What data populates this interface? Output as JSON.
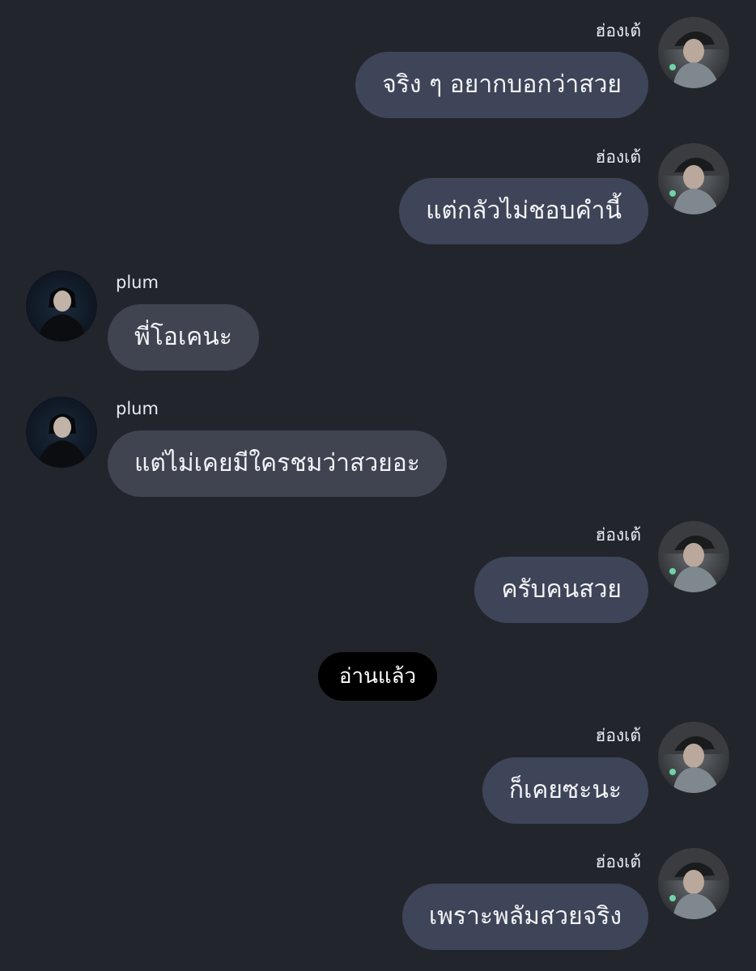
{
  "colors": {
    "background": "#23252d",
    "outgoing_bubble": "#3e4558",
    "incoming_bubble": "#404450",
    "read_pill": "#000000",
    "text": "#f3f4f7"
  },
  "messages": [
    {
      "sender": "ฮ่องเต้",
      "side": "right",
      "text": "จริง ๆ อยากบอกว่าสวย"
    },
    {
      "sender": "ฮ่องเต้",
      "side": "right",
      "text": "แต่กลัวไม่ชอบคำนี้"
    },
    {
      "sender": "plum",
      "side": "left",
      "text": "พี่โอเคนะ"
    },
    {
      "sender": "plum",
      "side": "left",
      "text": "แต่ไม่เคยมีใครชมว่าสวยอะ"
    },
    {
      "sender": "ฮ่องเต้",
      "side": "right",
      "text": "ครับคนสวย"
    },
    {
      "sender": "ฮ่องเต้",
      "side": "right",
      "text": "ก็เคยซะนะ"
    },
    {
      "sender": "ฮ่องเต้",
      "side": "right",
      "text": "เพราะพลัมสวยจริง"
    }
  ],
  "read_indicator": "อ่านแล้ว"
}
